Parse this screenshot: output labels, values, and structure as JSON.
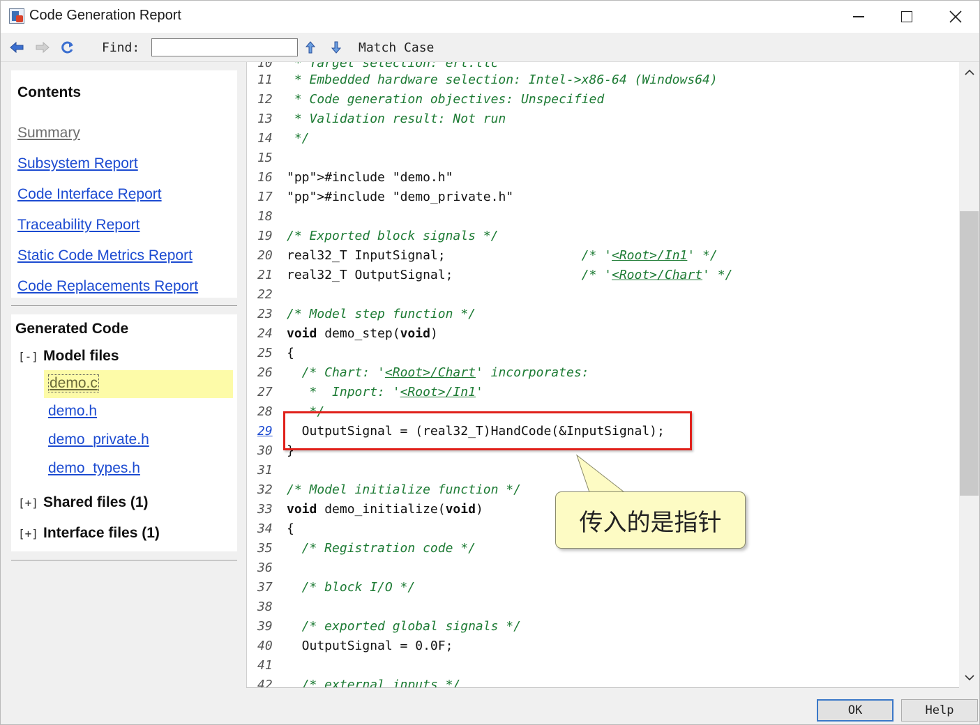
{
  "window": {
    "title": "Code Generation Report"
  },
  "toolbar": {
    "find_label": "Find:",
    "find_value": "",
    "match_case_label": "Match Case"
  },
  "contents": {
    "title": "Contents",
    "links": [
      {
        "label": "Summary",
        "visited": true
      },
      {
        "label": "Subsystem Report"
      },
      {
        "label": "Code Interface Report"
      },
      {
        "label": "Traceability Report"
      },
      {
        "label": "Static Code Metrics Report"
      },
      {
        "label": "Code Replacements Report"
      }
    ]
  },
  "generated_code": {
    "title": "Generated Code",
    "model_files": {
      "toggle": "[-]",
      "label": "Model files",
      "files": [
        "demo.c",
        "demo.h",
        "demo_private.h",
        "demo_types.h"
      ],
      "selected": "demo.c"
    },
    "shared_files": {
      "toggle": "[+]",
      "label": "Shared files (1)"
    },
    "interface_files": {
      "toggle": "[+]",
      "label": "Interface files (1)"
    }
  },
  "code": {
    "partial_top": {
      "num": "10",
      "text": " * Target selection: ert.tlc"
    },
    "lines": [
      {
        "num": "11",
        "text": " * Embedded hardware selection: Intel->x86-64 (Windows64)"
      },
      {
        "num": "12",
        "text": " * Code generation objectives: Unspecified"
      },
      {
        "num": "13",
        "text": " * Validation result: Not run"
      },
      {
        "num": "14",
        "text": " */"
      },
      {
        "num": "15",
        "text": ""
      },
      {
        "num": "16",
        "text": "#include \"demo.h\""
      },
      {
        "num": "17",
        "text": "#include \"demo_private.h\""
      },
      {
        "num": "18",
        "text": ""
      },
      {
        "num": "19",
        "text": "/* Exported block signals */"
      },
      {
        "num": "20",
        "text": "real32_T InputSignal;",
        "comment_pre": "/* '",
        "comment_link": "<Root>/In1",
        "comment_post": "' */"
      },
      {
        "num": "21",
        "text": "real32_T OutputSignal;",
        "comment_pre": "/* '",
        "comment_link": "<Root>/Chart",
        "comment_post": "' */"
      },
      {
        "num": "22",
        "text": ""
      },
      {
        "num": "23",
        "text": "/* Model step function */"
      },
      {
        "num": "24",
        "text": "void demo_step(void)"
      },
      {
        "num": "25",
        "text": "{"
      },
      {
        "num": "26",
        "text": "  /* Chart: '<Root>/Chart' incorporates:"
      },
      {
        "num": "27",
        "text": "   *  Inport: '<Root>/In1'"
      },
      {
        "num": "28",
        "text": "   */"
      },
      {
        "num": "29",
        "text": "  OutputSignal = (real32_T)HandCode(&InputSignal);"
      },
      {
        "num": "30",
        "text": "}"
      },
      {
        "num": "31",
        "text": ""
      },
      {
        "num": "32",
        "text": "/* Model initialize function */"
      },
      {
        "num": "33",
        "text": "void demo_initialize(void)"
      },
      {
        "num": "34",
        "text": "{"
      },
      {
        "num": "35",
        "text": "  /* Registration code */"
      },
      {
        "num": "36",
        "text": ""
      },
      {
        "num": "37",
        "text": "  /* block I/O */"
      },
      {
        "num": "38",
        "text": ""
      },
      {
        "num": "39",
        "text": "  /* exported global signals */"
      },
      {
        "num": "40",
        "text": "  OutputSignal = 0.0F;"
      },
      {
        "num": "41",
        "text": ""
      }
    ],
    "partial_bottom": {
      "num": "42",
      "text": "  /* external inputs */"
    }
  },
  "annotation": {
    "callout_text": "传入的是指针",
    "highlight_color": "#e0211b",
    "callout_fill": "#fdfbc4"
  },
  "buttons": {
    "ok": "OK",
    "help": "Help"
  },
  "colors": {
    "link": "#1c4bd1",
    "comment": "#1d7b34",
    "preprocessor": "#8b1a1a",
    "selected_file_bg": "#fdfba8"
  }
}
